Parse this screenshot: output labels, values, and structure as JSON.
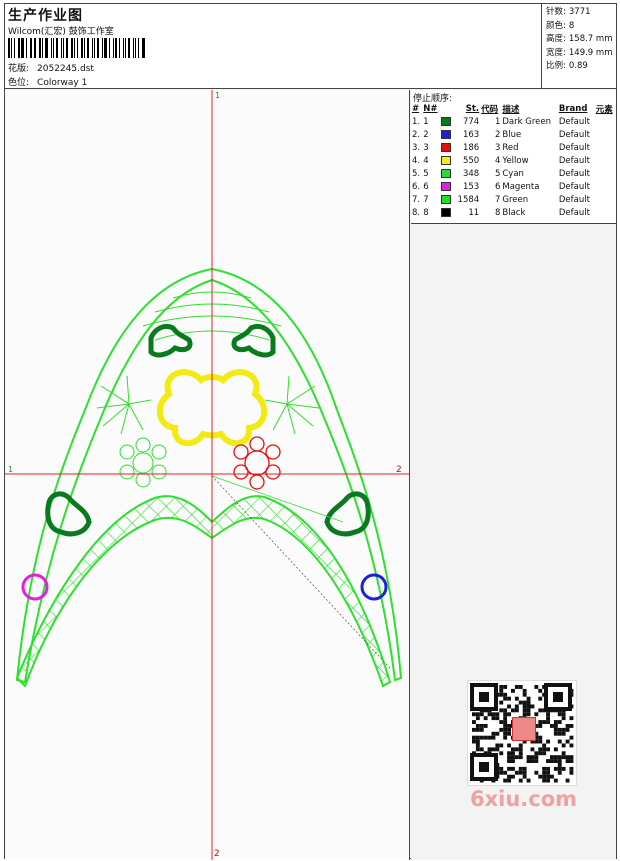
{
  "header": {
    "title": "生产作业图",
    "company": "Wilcom(汇宏) 鼓饰工作室",
    "pattern_label": "花版:",
    "pattern_value": "2052245.dst",
    "color_label": "色位:",
    "color_value": "Colorway 1"
  },
  "stats": [
    {
      "label": "针数:",
      "value": "3771"
    },
    {
      "label": "颜色:",
      "value": "8"
    },
    {
      "label": "高度:",
      "value": "158.7 mm"
    },
    {
      "label": "宽度:",
      "value": "149.9 mm"
    },
    {
      "label": "比例:",
      "value": "0.89"
    }
  ],
  "sequence": {
    "title": "停止顺序:",
    "headers": [
      "#",
      "N#",
      "St.",
      "代码",
      "描述",
      "Brand",
      "元素"
    ],
    "rows": [
      {
        "idx": "1.",
        "n": "1",
        "color": "#0a7a1e",
        "st": "774",
        "code": "1",
        "desc": "Dark Green",
        "brand": "Default"
      },
      {
        "idx": "2.",
        "n": "2",
        "color": "#1a22d8",
        "st": "163",
        "code": "2",
        "desc": "Blue",
        "brand": "Default"
      },
      {
        "idx": "3.",
        "n": "3",
        "color": "#e01010",
        "st": "186",
        "code": "3",
        "desc": "Red",
        "brand": "Default"
      },
      {
        "idx": "4.",
        "n": "4",
        "color": "#f5ec10",
        "st": "550",
        "code": "4",
        "desc": "Yellow",
        "brand": "Default"
      },
      {
        "idx": "5.",
        "n": "5",
        "color": "#2fd63a",
        "st": "348",
        "code": "5",
        "desc": "Cyan",
        "brand": "Default"
      },
      {
        "idx": "6.",
        "n": "6",
        "color": "#e21ee0",
        "st": "153",
        "code": "6",
        "desc": "Magenta",
        "brand": "Default"
      },
      {
        "idx": "7.",
        "n": "7",
        "color": "#22dd2a",
        "st": "1584",
        "code": "7",
        "desc": "Green",
        "brand": "Default"
      },
      {
        "idx": "8.",
        "n": "8",
        "color": "#000000",
        "st": "11",
        "code": "8",
        "desc": "Black",
        "brand": "Default"
      }
    ]
  },
  "canvas": {
    "axis_top": "1",
    "axis_left": "1",
    "axis_right": "2",
    "axis_bottom": "2"
  },
  "watermark": {
    "text": "6xiu.com"
  },
  "colors": {
    "axis": "#e02020",
    "outline_green": "#2ee02e",
    "dark_green": "#0a7a1e",
    "yellow": "#f2ea10",
    "red": "#e01010",
    "magenta": "#e21ee0",
    "blue": "#1a22d8"
  }
}
